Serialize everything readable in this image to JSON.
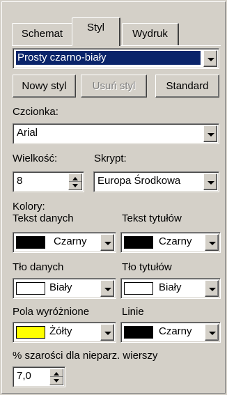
{
  "tabs": [
    {
      "label": "Schemat",
      "active": false
    },
    {
      "label": "Styl",
      "active": true
    },
    {
      "label": "Wydruk",
      "active": false
    }
  ],
  "style_select": {
    "value": "Prosty czarno-biały"
  },
  "buttons": {
    "new_style": "Nowy styl",
    "delete_style": "Usuń styl",
    "standard": "Standard"
  },
  "font": {
    "label": "Czcionka:",
    "value": "Arial"
  },
  "size": {
    "label": "Wielkość:",
    "value": "8"
  },
  "script": {
    "label": "Skrypt:",
    "value": "Europa Środkowa"
  },
  "colors": {
    "heading": "Kolory:",
    "data_text": {
      "label": "Tekst danych",
      "name": "Czarny",
      "hex": "#000000"
    },
    "title_text": {
      "label": "Tekst tytułów",
      "name": "Czarny",
      "hex": "#000000"
    },
    "data_bg": {
      "label": "Tło danych",
      "name": "Biały",
      "hex": "#ffffff"
    },
    "title_bg": {
      "label": "Tło tytułów",
      "name": "Biały",
      "hex": "#ffffff"
    },
    "highlight": {
      "label": "Pola wyróżnione",
      "name": "Żółty",
      "hex": "#ffff00"
    },
    "lines": {
      "label": "Linie",
      "name": "Czarny",
      "hex": "#000000"
    }
  },
  "gray": {
    "label": "% szarości dla nieparz. wierszy",
    "value": "7,0"
  }
}
